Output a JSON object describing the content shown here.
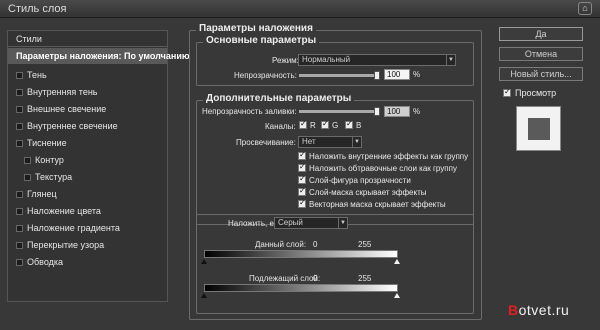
{
  "window": {
    "title": "Стиль слоя",
    "close_glyph": "⌂"
  },
  "sidebar": {
    "header": "Стили",
    "selected": "Параметры наложения: По умолчанию",
    "items": [
      {
        "label": "Тень"
      },
      {
        "label": "Внутренняя тень"
      },
      {
        "label": "Внешнее свечение"
      },
      {
        "label": "Внутреннее свечение"
      },
      {
        "label": "Тиснение"
      },
      {
        "label": "Контур"
      },
      {
        "label": "Текстура"
      },
      {
        "label": "Глянец"
      },
      {
        "label": "Наложение цвета"
      },
      {
        "label": "Наложение градиента"
      },
      {
        "label": "Перекрытие узора"
      },
      {
        "label": "Обводка"
      }
    ]
  },
  "blending": {
    "title": "Параметры наложения",
    "basic": {
      "title": "Основные параметры",
      "mode_label": "Режим:",
      "mode_value": "Нормальный",
      "opacity_label": "Непрозрачность:",
      "opacity_value": "100",
      "opacity_unit": "%",
      "opacity_level": 1.0
    },
    "advanced": {
      "title": "Дополнительные параметры",
      "fill_label": "Непрозрачность заливки:",
      "fill_value": "100",
      "fill_unit": "%",
      "fill_level": 1.0,
      "channels_label": "Каналы:",
      "channel_r": "R",
      "channel_g": "G",
      "channel_b": "B",
      "knockout_label": "Просвечивание:",
      "knockout_value": "Нет",
      "options": [
        "Наложить внутренние эффекты как группу",
        "Наложить обтравочные слои как группу",
        "Слой-фигура прозрачности",
        "Слой-маска скрывает эффекты",
        "Векторная маска скрывает эффекты"
      ]
    },
    "blend_if": {
      "label": "Наложить, если:",
      "value": "Серый",
      "this_layer_label": "Данный слой:",
      "this_layer_min": "0",
      "this_layer_max": "255",
      "underlying_label": "Подлежащий слой:",
      "underlying_min": "0",
      "underlying_max": "255"
    }
  },
  "buttons": {
    "ok": "Да",
    "cancel": "Отмена",
    "new_style": "Новый стиль...",
    "preview_label": "Просмотр"
  },
  "watermark": {
    "first": "B",
    "rest": "otvet.ru"
  }
}
